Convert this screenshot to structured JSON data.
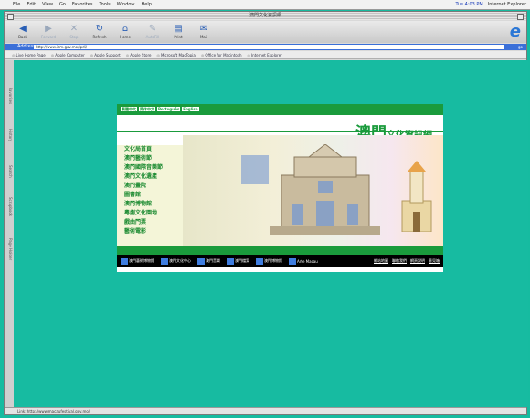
{
  "menubar": {
    "items": [
      "File",
      "Edit",
      "View",
      "Go",
      "Favorites",
      "Tools",
      "Window",
      "Help"
    ],
    "clock": "Tue 4:03 PM",
    "app_name": "Internet Explorer"
  },
  "window": {
    "title": "澳門文化資訊網"
  },
  "toolbar": {
    "buttons": [
      "Back",
      "Forward",
      "Stop",
      "Refresh",
      "Home",
      "AutoFill",
      "Print",
      "Mail"
    ]
  },
  "address": {
    "label": "Address",
    "url": "http://www.icm.gov.mo/lpdi/",
    "go": "go"
  },
  "links_bar": [
    "Live Home Page",
    "Apple Computer",
    "Apple Support",
    "Apple Store",
    "Microsoft MacTopia",
    "Office for Macintosh",
    "Internet Explorer"
  ],
  "side_tabs": [
    "Favorites",
    "History",
    "Search",
    "Scrapbook",
    "Page Holder"
  ],
  "page": {
    "langs": [
      "繁體中文",
      "简体中文",
      "Português",
      "English"
    ],
    "brand_big": "澳門",
    "brand_small": "文化資訊網",
    "menu": [
      "文化局首頁",
      "澳門藝術節",
      "澳門國際音樂節",
      "澳門文化遺產",
      "澳門畫院",
      "圖書館",
      "澳門博物館",
      "粵劇文化園地",
      "戲曲門票",
      "藝術電影"
    ],
    "footer_logos": [
      "澳門藝術博物館",
      "澳門文化中心",
      "澳門音樂",
      "澳門檔案",
      "澳門博物館",
      "Arte Macau"
    ],
    "footer_links": [
      "網站地圖",
      "聯絡我們",
      "網頁說明",
      "意見箱"
    ]
  },
  "status": {
    "text": "Link: http://www.macaufestival.gov.mo/"
  }
}
